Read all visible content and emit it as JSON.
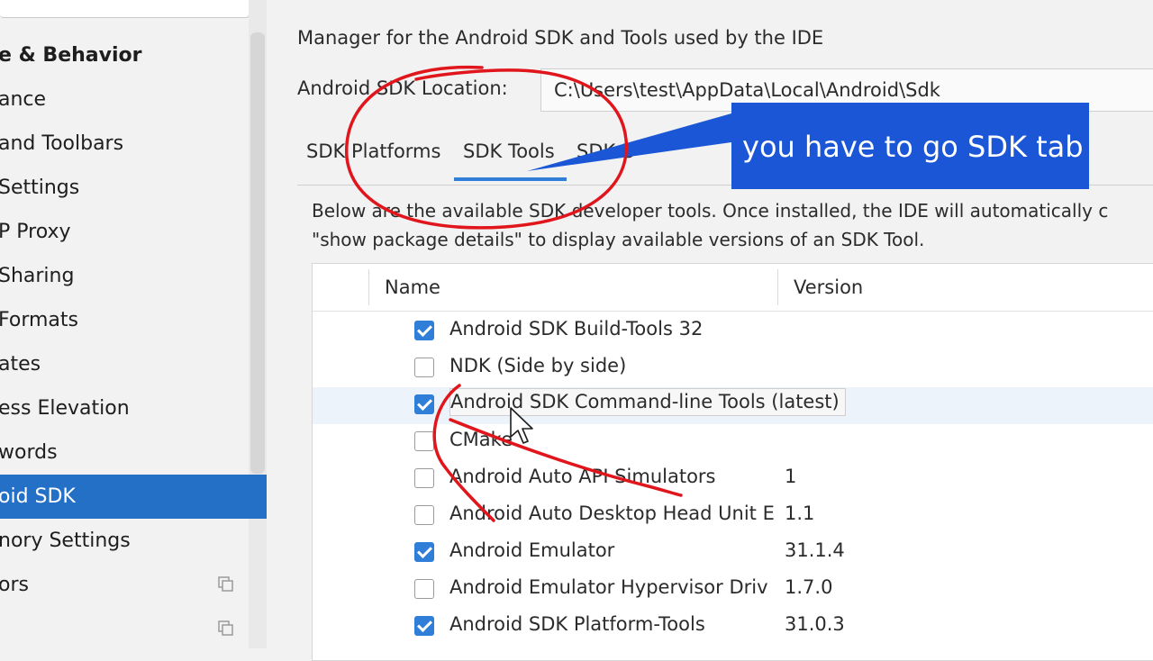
{
  "sidebar": {
    "items": [
      {
        "label": "e & Behavior",
        "heading": true
      },
      {
        "label": "ance"
      },
      {
        "label": "and Toolbars"
      },
      {
        "label": "Settings"
      },
      {
        "label": "P Proxy"
      },
      {
        "label": "Sharing"
      },
      {
        "label": "Formats"
      },
      {
        "label": "ates"
      },
      {
        "label": "ess Elevation"
      },
      {
        "label": "words"
      },
      {
        "label": "oid SDK",
        "selected": true
      },
      {
        "label": "nory Settings"
      },
      {
        "label": "ors",
        "copy_icon": true
      },
      {
        "label": "",
        "copy_icon": true
      }
    ]
  },
  "main": {
    "description": "Manager for the Android SDK and Tools used by the IDE",
    "location_label": "Android SDK Location:",
    "location_value": "C:\\Users\\test\\AppData\\Local\\Android\\Sdk",
    "tabs": [
      {
        "label": "SDK Platforms"
      },
      {
        "label": "SDK Tools",
        "active": true
      },
      {
        "label": "SDK U"
      }
    ],
    "panel_text_line1": "Below are the available SDK developer tools. Once installed, the IDE will automatically c",
    "panel_text_line2": "\"show package details\" to display available versions of an SDK Tool.",
    "table": {
      "columns": [
        "Name",
        "Version"
      ],
      "rows": [
        {
          "name": "Android SDK Build-Tools 32",
          "version": "",
          "checked": true
        },
        {
          "name": "NDK (Side by side)",
          "version": "",
          "checked": false
        },
        {
          "name": "Android SDK Command-line Tools (latest)",
          "version": "",
          "checked": true,
          "hover": true
        },
        {
          "name": "CMake",
          "version": "",
          "checked": false
        },
        {
          "name": "Android Auto API Simulators",
          "version": "1",
          "checked": false
        },
        {
          "name": "Android Auto Desktop Head Unit E",
          "version": "1.1",
          "checked": false
        },
        {
          "name": "Android Emulator",
          "version": "31.1.4",
          "checked": true
        },
        {
          "name": "Android Emulator Hypervisor Driv",
          "version": "1.7.0",
          "checked": false
        },
        {
          "name": "Android SDK Platform-Tools",
          "version": "31.0.3",
          "checked": true
        }
      ]
    }
  },
  "callout": {
    "text": "you have to go SDK tab",
    "color": "#1a56d6"
  },
  "colors": {
    "accent": "#2f7ed8",
    "selection": "#2470c7",
    "annotation": "#e0161c"
  }
}
